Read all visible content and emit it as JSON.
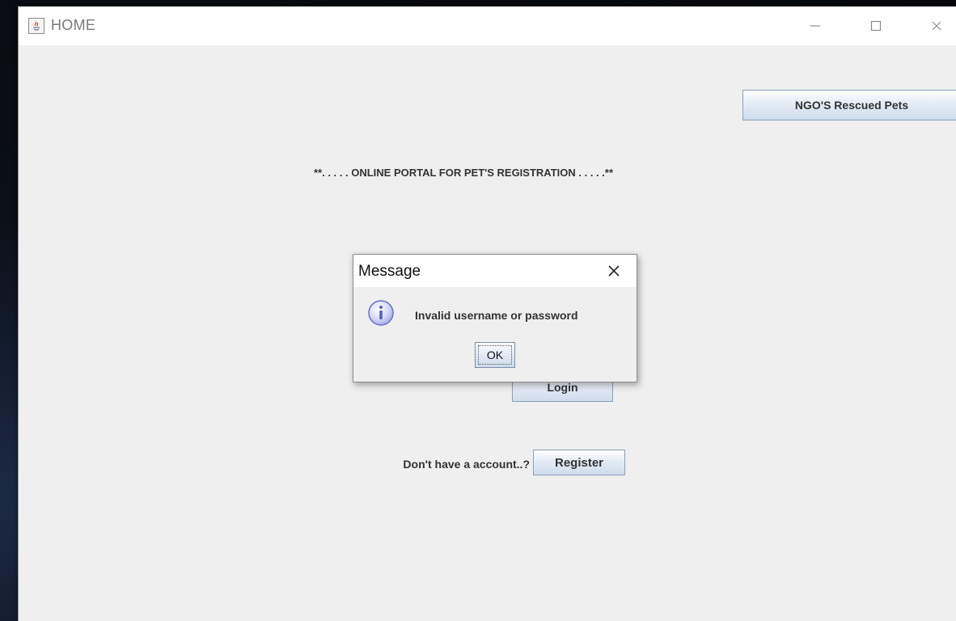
{
  "window": {
    "title": "HOME",
    "controls": {
      "minimize": "minimize-icon",
      "maximize": "maximize-icon",
      "close": "close-icon"
    }
  },
  "main": {
    "ngo_button_label": "NGO'S Rescued Pets",
    "portal_title": "**. . . . . ONLINE PORTAL FOR PET'S REGISTRATION . . . . .**",
    "login_button_label": "Login",
    "register_prompt": "Don't have a account..?",
    "register_button_label": "Register"
  },
  "dialog": {
    "title": "Message",
    "message": "Invalid username or password",
    "ok_label": "OK",
    "icon": "info-icon"
  },
  "colors": {
    "window_bg": "#efefef",
    "button_border": "#8aa1bb",
    "info_icon": "#6b6fd1"
  }
}
